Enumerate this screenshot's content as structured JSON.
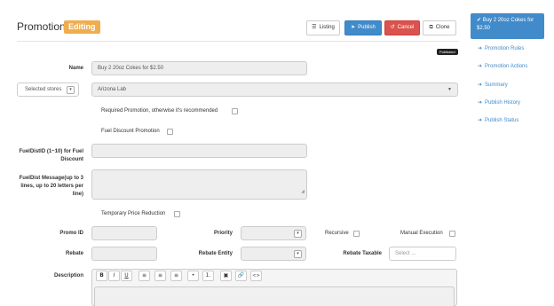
{
  "header": {
    "title": "Promotion",
    "status_badge": "Editing",
    "buttons": {
      "listing": "Listing",
      "publish": "Publish",
      "cancel": "Cancel",
      "clone": "Clone"
    },
    "published_tag": "Published"
  },
  "form": {
    "name_label": "Name",
    "name_value": "Buy 2 20oz Cokes for $2.50",
    "store_select_label": "Selected stores",
    "store_value": "Arizona Lab",
    "required_promo_label": "Required Promotion, otherwise it's recommended",
    "fuel_discount_label": "Fuel Discount Promotion",
    "fueldist_id_label": "FuelDistID (1~10) for Fuel Discount",
    "fueldist_msg_label": "FuelDist Message(up to 3 lines, up to 20 letters per line)",
    "temp_price_label": "Temporary Price Reduction",
    "promo_id_label": "Promo ID",
    "priority_label": "Priority",
    "recursive_label": "Recursive",
    "manual_exec_label": "Manual Execution",
    "rebate_label": "Rebate",
    "rebate_entity_label": "Rebate Entity",
    "rebate_taxable_label": "Rebate Taxable",
    "rebate_taxable_placeholder": "Select ...",
    "description_label": "Description"
  },
  "editor_toolbar": [
    "B",
    "I",
    "U",
    "≡",
    "≡",
    "≡",
    "•",
    "1.",
    "▣",
    "🔗",
    "<>"
  ],
  "sidebar": {
    "active": "Buy 2 20oz Cokes for $2.50",
    "items": [
      "Promotion Rules",
      "Promotion Actions",
      "Summary",
      "Publish History",
      "Publish Status"
    ]
  },
  "colors": {
    "primary": "#428bca",
    "danger": "#d9534f",
    "warning": "#f0ad4e"
  }
}
